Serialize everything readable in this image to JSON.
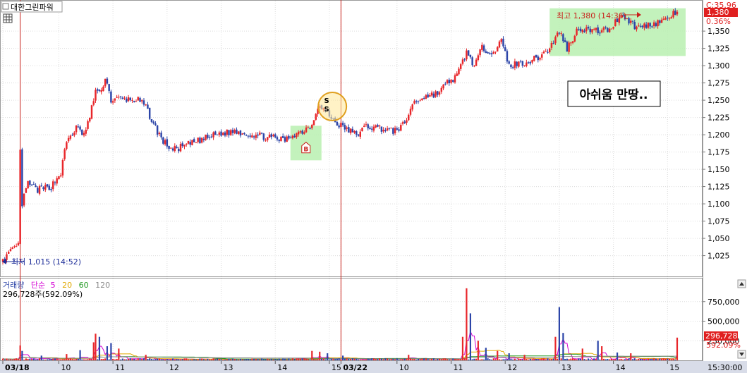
{
  "header": {
    "stock_name": "대한그린파워",
    "close_label": "C:35.96"
  },
  "colors": {
    "up": "#e8262a",
    "down": "#2c45a8",
    "vline": "#c8201a",
    "highlight": "#b8f0b0",
    "ma5": "#d400d4",
    "ma20": "#e0a800",
    "ma60": "#229922",
    "ma120": "#8a8a8a",
    "price_badge": "#e02020"
  },
  "chart_data": [
    {
      "type": "candlestick",
      "title": "대한그린파워",
      "y_ticks": [
        1025,
        1050,
        1075,
        1100,
        1125,
        1150,
        1175,
        1200,
        1225,
        1250,
        1275,
        1300,
        1325,
        1350
      ],
      "ylim": [
        997,
        1393
      ],
      "y_tick_labels": [
        "1,025",
        "1,050",
        "1,075",
        "1,100",
        "1,125",
        "1,150",
        "1,175",
        "1,200",
        "1,225",
        "1,250",
        "1,275",
        "1,300",
        "1,325",
        "1,350"
      ],
      "x_tick_labels": [
        "03/18",
        "10",
        "11",
        "12",
        "13",
        "14",
        "15",
        "03/22",
        "10",
        "11",
        "12",
        "13",
        "14",
        "15"
      ],
      "current_price": 1380,
      "current_price_label": "1,380",
      "current_change_label": "0.36%",
      "price_keypoints": [
        [
          0,
          1020
        ],
        [
          8,
          1040
        ],
        [
          9,
          1175
        ],
        [
          10,
          1100
        ],
        [
          13,
          1130
        ],
        [
          18,
          1120
        ],
        [
          25,
          1125
        ],
        [
          30,
          1145
        ],
        [
          33,
          1190
        ],
        [
          38,
          1210
        ],
        [
          42,
          1200
        ],
        [
          45,
          1225
        ],
        [
          48,
          1265
        ],
        [
          51,
          1260
        ],
        [
          53,
          1285
        ],
        [
          56,
          1250
        ],
        [
          60,
          1252
        ],
        [
          70,
          1250
        ],
        [
          74,
          1240
        ],
        [
          78,
          1215
        ],
        [
          83,
          1190
        ],
        [
          88,
          1178
        ],
        [
          95,
          1185
        ],
        [
          110,
          1200
        ],
        [
          120,
          1205
        ],
        [
          130,
          1200
        ],
        [
          140,
          1195
        ],
        [
          146,
          1192
        ],
        [
          150,
          1200
        ],
        [
          155,
          1205
        ],
        [
          160,
          1215
        ],
        [
          163,
          1242
        ],
        [
          167,
          1235
        ],
        [
          172,
          1218
        ],
        [
          178,
          1208
        ],
        [
          183,
          1200
        ],
        [
          188,
          1212
        ],
        [
          195,
          1210
        ],
        [
          202,
          1205
        ],
        [
          208,
          1215
        ],
        [
          212,
          1245
        ],
        [
          218,
          1255
        ],
        [
          225,
          1260
        ],
        [
          230,
          1275
        ],
        [
          235,
          1285
        ],
        [
          240,
          1320
        ],
        [
          244,
          1300
        ],
        [
          248,
          1325
        ],
        [
          254,
          1320
        ],
        [
          258,
          1335
        ],
        [
          262,
          1300
        ],
        [
          270,
          1305
        ],
        [
          276,
          1310
        ],
        [
          283,
          1325
        ],
        [
          288,
          1350
        ],
        [
          292,
          1325
        ],
        [
          298,
          1355
        ],
        [
          306,
          1350
        ],
        [
          314,
          1352
        ],
        [
          320,
          1375
        ],
        [
          328,
          1355
        ],
        [
          335,
          1360
        ],
        [
          342,
          1365
        ],
        [
          349,
          1378
        ]
      ],
      "annotations": {
        "low_label": "최저 1,015 (14:52)",
        "high_label": "최고 1,380 (14:36)",
        "comment": "아쉬움 만땅..",
        "buy_marker": "B",
        "sell_marker": "S"
      }
    },
    {
      "type": "bar",
      "title": "거래량",
      "legend": [
        {
          "name": "거래량",
          "color": "#2c45a8"
        },
        {
          "name": "단순",
          "color": "#d400d4"
        },
        {
          "name": "5",
          "color": "#d400d4"
        },
        {
          "name": "20",
          "color": "#e0a800"
        },
        {
          "name": "60",
          "color": "#229922"
        },
        {
          "name": "120",
          "color": "#8a8a8a"
        }
      ],
      "y_ticks": [
        250000,
        500000,
        750000
      ],
      "y_tick_labels": [
        "250,000",
        "500,000",
        "750,000"
      ],
      "ylim": [
        0,
        1000000
      ],
      "current_volume_label": "296,728주(592.09%)",
      "current_volume": "296,728",
      "current_volume_pct": "592.09%",
      "time_label": "15:30:00",
      "spikes": [
        [
          9,
          190000
        ],
        [
          10,
          120000
        ],
        [
          20,
          60000
        ],
        [
          33,
          80000
        ],
        [
          40,
          130000
        ],
        [
          47,
          230000
        ],
        [
          48,
          340000
        ],
        [
          50,
          300000
        ],
        [
          54,
          180000
        ],
        [
          56,
          220000
        ],
        [
          60,
          150000
        ],
        [
          74,
          70000
        ],
        [
          160,
          120000
        ],
        [
          164,
          110000
        ],
        [
          168,
          90000
        ],
        [
          176,
          60000
        ],
        [
          210,
          70000
        ],
        [
          238,
          300000
        ],
        [
          240,
          920000
        ],
        [
          242,
          600000
        ],
        [
          246,
          250000
        ],
        [
          250,
          160000
        ],
        [
          256,
          120000
        ],
        [
          262,
          90000
        ],
        [
          270,
          70000
        ],
        [
          286,
          300000
        ],
        [
          288,
          680000
        ],
        [
          290,
          350000
        ],
        [
          300,
          150000
        ],
        [
          308,
          250000
        ],
        [
          310,
          180000
        ],
        [
          318,
          100000
        ],
        [
          325,
          90000
        ],
        [
          349,
          290000
        ]
      ]
    }
  ]
}
